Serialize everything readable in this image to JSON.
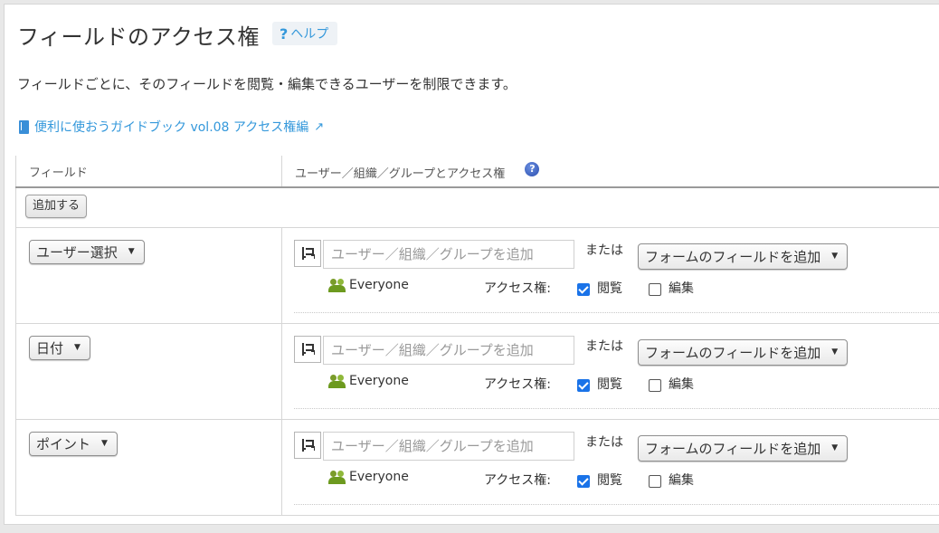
{
  "header": {
    "title": "フィールドのアクセス権",
    "help_label": "ヘルプ",
    "help_icon": "?"
  },
  "description": "フィールドごとに、そのフィールドを閲覧・編集できるユーザーを制限できます。",
  "guide_link": {
    "label": "便利に使おうガイドブック vol.08 アクセス権編",
    "icon": "book-icon",
    "external_icon": "external-link-icon"
  },
  "table": {
    "col_field": "フィールド",
    "col_access": "ユーザー／組織／グループとアクセス権",
    "add_label": "追加する",
    "rows": [
      {
        "field": "ユーザー選択",
        "user_placeholder": "ユーザー／組織／グループを追加",
        "or_label": "または",
        "form_field_label": "フォームのフィールドを追加",
        "entity": "Everyone",
        "access_label": "アクセス権:",
        "view_label": "閲覧",
        "view_checked": true,
        "edit_label": "編集",
        "edit_checked": false
      },
      {
        "field": "日付",
        "user_placeholder": "ユーザー／組織／グループを追加",
        "or_label": "または",
        "form_field_label": "フォームのフィールドを追加",
        "entity": "Everyone",
        "access_label": "アクセス権:",
        "view_label": "閲覧",
        "view_checked": true,
        "edit_label": "編集",
        "edit_checked": false
      },
      {
        "field": "ポイント",
        "user_placeholder": "ユーザー／組織／グループを追加",
        "or_label": "または",
        "form_field_label": "フォームのフィールドを追加",
        "entity": "Everyone",
        "access_label": "アクセス権:",
        "view_label": "閲覧",
        "view_checked": true,
        "edit_label": "編集",
        "edit_checked": false
      }
    ]
  },
  "colors": {
    "link": "#3498db",
    "checkbox": "#1a73e8",
    "border": "#d6d6d6"
  }
}
